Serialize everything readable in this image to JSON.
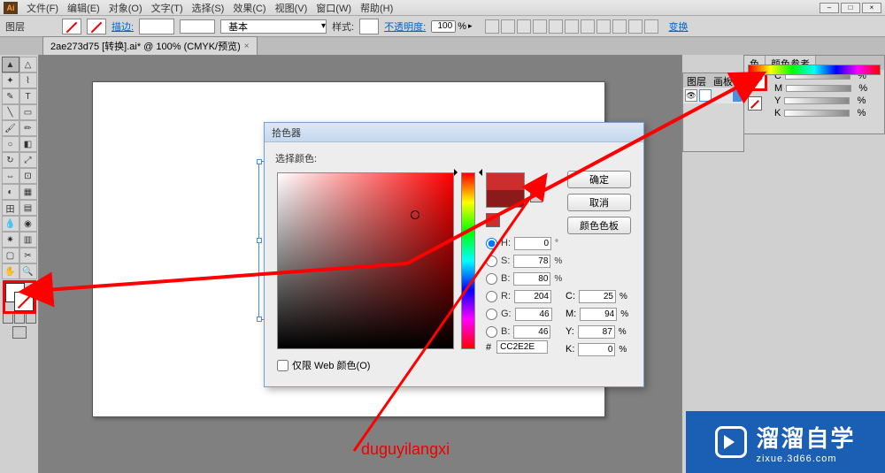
{
  "app": {
    "logo": "Ai"
  },
  "menu": {
    "file": "文件(F)",
    "edit": "编辑(E)",
    "object": "对象(O)",
    "type": "文字(T)",
    "select": "选择(S)",
    "effect": "效果(C)",
    "view": "视图(V)",
    "window": "窗口(W)",
    "help": "帮助(H)"
  },
  "optbar": {
    "layer_label": "图层",
    "stroke_label": "描边:",
    "style_label": "样式:",
    "style_value": "基本",
    "opacity_label": "不透明度:",
    "opacity_value": "100",
    "opacity_unit": "%",
    "transform": "变换"
  },
  "doc": {
    "tab": "2ae273d75 [转换].ai* @ 100% (CMYK/预览)",
    "close": "×"
  },
  "dialog": {
    "title": "拾色器",
    "select_label": "选择颜色:",
    "ok": "确定",
    "cancel": "取消",
    "swatches": "颜色色板",
    "H": "H:",
    "H_v": "0",
    "H_u": "°",
    "S": "S:",
    "S_v": "78",
    "S_u": "%",
    "Bv": "B:",
    "Bv_v": "80",
    "Bv_u": "%",
    "R": "R:",
    "R_v": "204",
    "G": "G:",
    "G_v": "46",
    "B": "B:",
    "B_v": "46",
    "C": "C:",
    "C_v": "25",
    "C_u": "%",
    "M": "M:",
    "M_v": "94",
    "M_u": "%",
    "Y": "Y:",
    "Y_v": "87",
    "Y_u": "%",
    "K": "K:",
    "K_v": "0",
    "K_u": "%",
    "hash": "#",
    "hex": "CC2E2E",
    "web_only": "仅限 Web 颜色(O)"
  },
  "panels": {
    "layers_tab1": "图层",
    "layers_tab2": "画板",
    "color_tab1": "色",
    "color_tab2": "颜色参考",
    "C": "C",
    "M": "M",
    "Y": "Y",
    "K": "K",
    "pct": "%"
  },
  "annotation": {
    "watermark": "duguyilangxi"
  },
  "brand": {
    "cn": "溜溜自学",
    "en": "zixue.3d66.com"
  }
}
